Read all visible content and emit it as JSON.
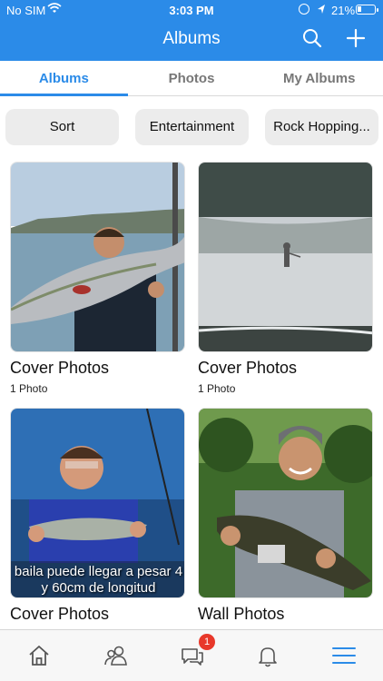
{
  "status_bar": {
    "carrier": "No SIM",
    "time": "3:03 PM",
    "battery_percent": "21%",
    "battery_level": 0.21,
    "icons": [
      "wifi-icon",
      "orientation-lock-icon",
      "location-arrow-icon",
      "battery-icon"
    ]
  },
  "nav": {
    "title": "Albums",
    "icons": [
      "search-icon",
      "plus-icon"
    ]
  },
  "tabs": [
    {
      "label": "Albums",
      "active": true
    },
    {
      "label": "Photos",
      "active": false
    },
    {
      "label": "My Albums",
      "active": false
    }
  ],
  "filters": [
    {
      "label": "Sort"
    },
    {
      "label": "Entertainment"
    },
    {
      "label": "Rock Hopping..."
    }
  ],
  "albums": [
    {
      "title": "Cover Photos",
      "count": "1 Photo"
    },
    {
      "title": "Cover Photos",
      "count": "1 Photo"
    },
    {
      "title": "Cover Photos",
      "count": "",
      "caption_lines": [
        "baila puede llegar a pesar 4",
        "y 60cm de longitud"
      ]
    },
    {
      "title": "Wall Photos",
      "count": ""
    }
  ],
  "tab_bar": {
    "items": [
      "home-icon",
      "friends-icon",
      "chat-icon",
      "bell-icon",
      "menu-icon"
    ],
    "chat_badge": "1"
  },
  "colors": {
    "accent": "#2b8be8",
    "badge": "#e8382a"
  }
}
